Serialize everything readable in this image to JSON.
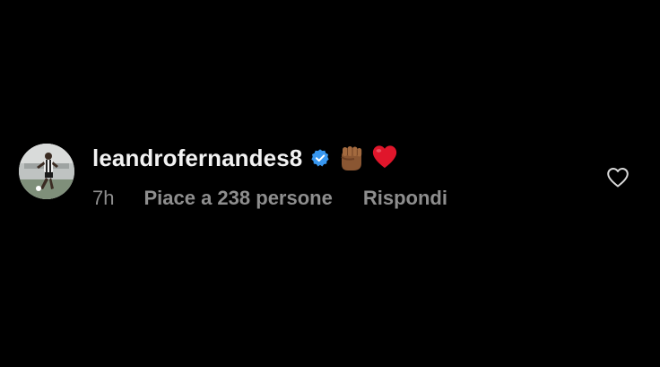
{
  "comment": {
    "username": "leandrofernandes8",
    "verified": true,
    "emojis": [
      "raised-fist-dark-skin",
      "red-heart"
    ],
    "time": "7h",
    "likes_text": "Piace a 238 persone",
    "reply_label": "Rispondi",
    "like_icon": "heart-outline-icon"
  },
  "colors": {
    "background": "#000000",
    "username": "#f2f2f2",
    "meta": "#8e8e8e",
    "verified_badge": "#3897f0",
    "heart_emoji": "#e0162b",
    "like_icon": "#d8d8d8"
  }
}
